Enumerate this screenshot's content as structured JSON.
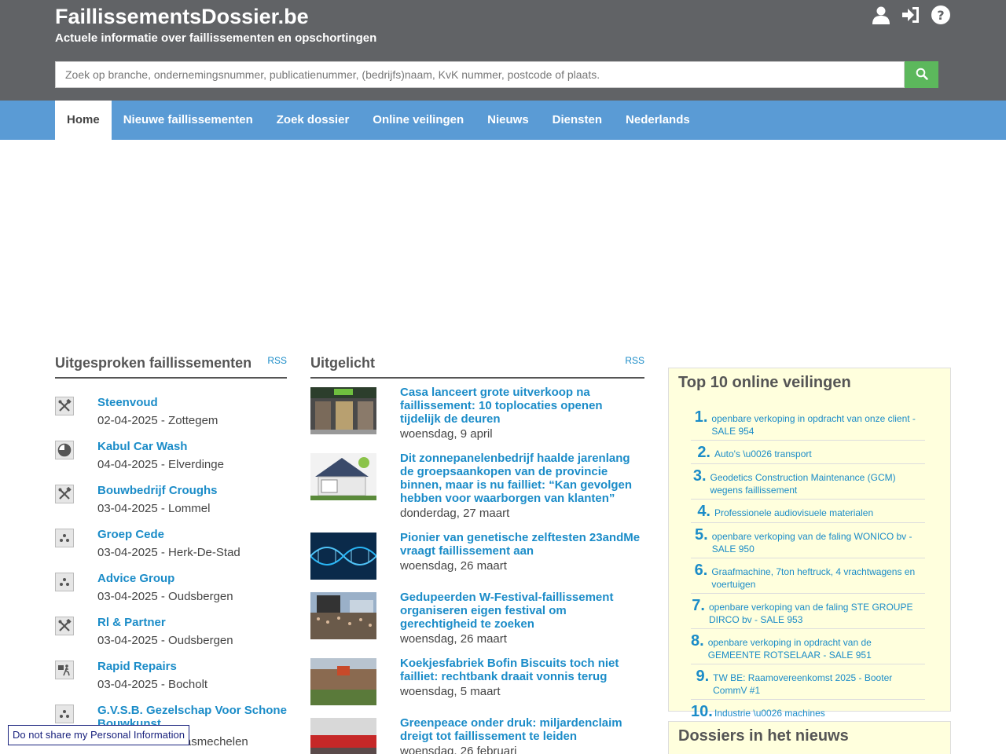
{
  "header": {
    "title": "FaillissementsDossier.be",
    "subtitle": "Actuele informatie over faillissementen en opschortingen",
    "search_placeholder": "Zoek op branche, ondernemingsnummer, publicatienummer, (bedrijfs)naam, KvK nummer, postcode of plaats.",
    "icons": [
      "user-icon",
      "sign-in-icon",
      "help-icon"
    ]
  },
  "nav": {
    "items": [
      "Home",
      "Nieuwe faillissementen",
      "Zoek dossier",
      "Online veilingen",
      "Nieuws",
      "Diensten",
      "Nederlands"
    ],
    "active": "Home"
  },
  "bankruptcies": {
    "title": "Uitgesproken faillissementen",
    "rss": "RSS",
    "items": [
      {
        "name": "Steenvoud",
        "meta": "02-04-2025 - Zottegem",
        "icon": "tools-icon"
      },
      {
        "name": "Kabul Car Wash",
        "meta": "04-04-2025 - Elverdinge",
        "icon": "pie-icon"
      },
      {
        "name": "Bouwbedrijf Croughs",
        "meta": "03-04-2025 - Lommel",
        "icon": "tools-icon"
      },
      {
        "name": "Groep Cede",
        "meta": "03-04-2025 - Herk-De-Stad",
        "icon": "group-icon"
      },
      {
        "name": "Advice Group",
        "meta": "03-04-2025 - Oudsbergen",
        "icon": "group-icon"
      },
      {
        "name": "Rl & Partner",
        "meta": "03-04-2025 - Oudsbergen",
        "icon": "tools-icon"
      },
      {
        "name": "Rapid Repairs",
        "meta": "03-04-2025 - Bocholt",
        "icon": "delivery-icon"
      },
      {
        "name": "G.V.S.B. Gezelschap Voor Schone Bouwkunst",
        "meta": "03-04-2025 - Maasmechelen",
        "icon": "group-icon"
      }
    ]
  },
  "featured": {
    "title": "Uitgelicht",
    "rss": "RSS",
    "items": [
      {
        "title": "Casa lanceert grote uitverkoop na faillissement: 10 toplocaties openen tijdelijk de deuren",
        "date": "woensdag, 9 april",
        "thumb": "store-photo"
      },
      {
        "title": "Dit zonnepanelenbedrijf haalde jarenlang de groepsaankopen van de provincie binnen, maar is nu failliet: “Kan gevolgen hebben voor waarborgen van klanten”",
        "date": "donderdag, 27 maart",
        "thumb": "solar-house-photo"
      },
      {
        "title": "Pionier van genetische zelftesten 23andMe vraagt faillissement aan",
        "date": "woensdag, 26 maart",
        "thumb": "dna-photo"
      },
      {
        "title": "Gedupeerden W-Festival-faillissement organiseren eigen festival om gerechtigheid te zoeken",
        "date": "woensdag, 26 maart",
        "thumb": "festival-photo"
      },
      {
        "title": "Koekjesfabriek Bofin Biscuits toch niet failliet: rechtbank draait vonnis terug",
        "date": "woensdag, 5 maart",
        "thumb": "factory-photo"
      },
      {
        "title": "Greenpeace onder druk: miljardenclaim dreigt tot faillissement te leiden",
        "date": "woensdag, 26 februari",
        "thumb": "protest-photo"
      }
    ]
  },
  "auctions": {
    "title": "Top 10 online veilingen",
    "items": [
      {
        "num": "1.",
        "text": "openbare verkoping in opdracht van onze client - SALE 954"
      },
      {
        "num": "2.",
        "text": "Auto's \\u0026 transport"
      },
      {
        "num": "3.",
        "text": "Geodetics Construction Maintenance (GCM) wegens faillissement"
      },
      {
        "num": "4.",
        "text": "Professionele audiovisuele materialen"
      },
      {
        "num": "5.",
        "text": "openbare verkoping van de faling WONICO bv - SALE 950"
      },
      {
        "num": "6.",
        "text": "Graafmachine, 7ton heftruck, 4 vrachtwagens en voertuigen"
      },
      {
        "num": "7.",
        "text": "openbare verkoping van de faling STE GROUPE DIRCO bv - SALE 953"
      },
      {
        "num": "8.",
        "text": "openbare verkoping in opdracht van de GEMEENTE ROTSELAAR - SALE 951"
      },
      {
        "num": "9.",
        "text": "TW BE: Raamovereenkomst 2025 - Booter CommV #1"
      },
      {
        "num": "10.",
        "text": "Industrie \\u0026 machines"
      }
    ]
  },
  "news_dossiers": {
    "title": "Dossiers in het nieuws"
  },
  "privacy": {
    "label": "Do not share my Personal Information"
  },
  "colors": {
    "header_bg": "#616366",
    "nav_bg": "#5a9bd5",
    "link": "#1b8cc8",
    "search_button": "#5cb85c",
    "box_bg": "#ffffdd"
  }
}
